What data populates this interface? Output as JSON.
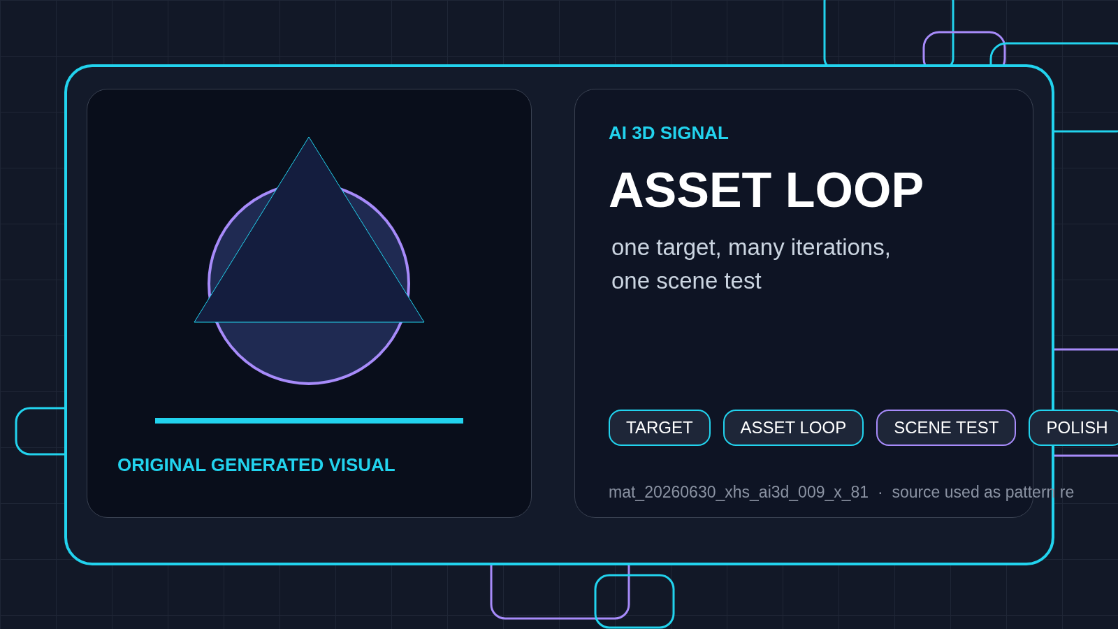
{
  "visual": {
    "caption": "ORIGINAL GENERATED VISUAL"
  },
  "info": {
    "eyebrow": "AI 3D SIGNAL",
    "title": "ASSET LOOP",
    "subtitle_lines": [
      "one target, many iterations,",
      "one scene test"
    ],
    "tags": [
      {
        "label": "TARGET",
        "color": "#22d3ee"
      },
      {
        "label": "ASSET LOOP",
        "color": "#22d3ee"
      },
      {
        "label": "SCENE TEST",
        "color": "#a78bfa"
      },
      {
        "label": "POLISH",
        "color": "#22d3ee"
      }
    ],
    "footer": "mat_20260630_xhs_ai3d_009_x_81  ·  source used as pattern re"
  }
}
